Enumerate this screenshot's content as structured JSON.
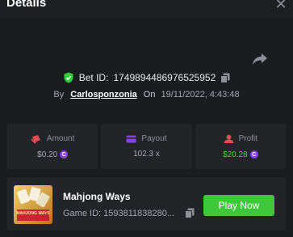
{
  "header": {
    "title": "Details",
    "close_glyph": "✕"
  },
  "bet": {
    "prefix": "Bet ID:",
    "id": "1749894486976525952"
  },
  "meta": {
    "by_label": "By",
    "username": "Carlosponzonia",
    "on_label": "On",
    "datetime": "19/11/2022, 4:43:48"
  },
  "stats": [
    {
      "label": "Amount",
      "value": "$0.20",
      "icon": "bet-icon",
      "coin": true,
      "color": "#a6a9b0"
    },
    {
      "label": "Payout",
      "value": "102.3 x",
      "icon": "payout-icon",
      "coin": false,
      "color": "#a6a9b0"
    },
    {
      "label": "Profit",
      "value": "$20.28",
      "icon": "profit-icon",
      "coin": true,
      "color": "#3fdc35"
    }
  ],
  "coin_glyph": "C",
  "game": {
    "name": "Mahjong Ways",
    "id_label": "Game ID: 1593811838280...",
    "play_label": "Play Now",
    "thumb_text": "MAHJONG WAYS"
  },
  "colors": {
    "accent_green": "#3ec73a",
    "shield_green": "#2fcf3a",
    "coin_purple": "#8a3ff0",
    "background": "#1b1c20"
  }
}
